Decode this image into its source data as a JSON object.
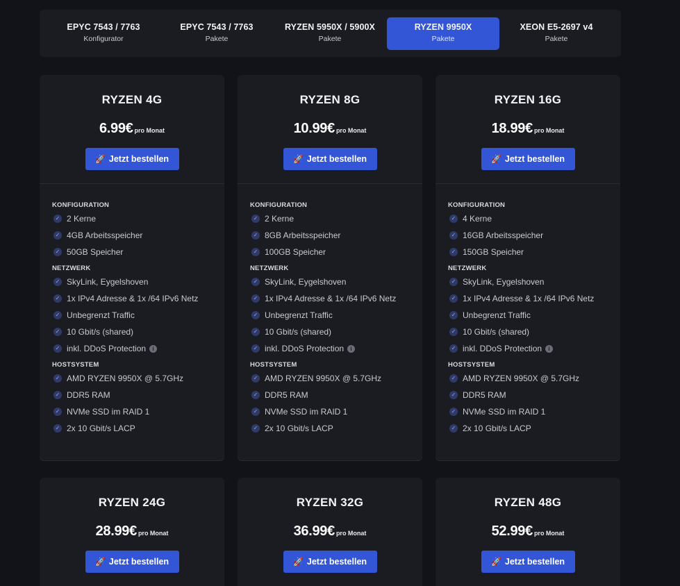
{
  "tabs": [
    {
      "title": "EPYC 7543 / 7763",
      "subtitle": "Konfigurator",
      "active": false
    },
    {
      "title": "EPYC 7543 / 7763",
      "subtitle": "Pakete",
      "active": false
    },
    {
      "title": "RYZEN 5950X / 5900X",
      "subtitle": "Pakete",
      "active": false
    },
    {
      "title": "RYZEN 9950X",
      "subtitle": "Pakete",
      "active": true
    },
    {
      "title": "XEON E5-2697 v4",
      "subtitle": "Pakete",
      "active": false
    }
  ],
  "colors": {
    "accent": "#3356d6",
    "background": "#121318",
    "card": "#1b1c22"
  },
  "icons": {
    "order": "rocket-icon",
    "check": "check-circle-icon",
    "info": "info-icon"
  },
  "labels": {
    "per_month": "pro Monat",
    "order_button": "Jetzt bestellen",
    "section_config": "KONFIGURATION",
    "section_network": "NETZWERK",
    "section_host": "HOSTSYSTEM"
  },
  "plans": [
    {
      "name": "RYZEN 4G",
      "price": "6.99€",
      "config": [
        "2 Kerne",
        "4GB Arbeitsspeicher",
        "50GB Speicher"
      ],
      "network": [
        "SkyLink, Eygelshoven",
        "1x IPv4 Adresse & 1x /64 IPv6 Netz",
        "Unbegrenzt Traffic",
        "10 Gbit/s (shared)",
        "inkl. DDoS Protection"
      ],
      "host": [
        "AMD RYZEN 9950X @ 5.7GHz",
        "DDR5 RAM",
        "NVMe SSD im RAID 1",
        "2x 10 Gbit/s LACP"
      ]
    },
    {
      "name": "RYZEN 8G",
      "price": "10.99€",
      "config": [
        "2 Kerne",
        "8GB Arbeitsspeicher",
        "100GB Speicher"
      ],
      "network": [
        "SkyLink, Eygelshoven",
        "1x IPv4 Adresse & 1x /64 IPv6 Netz",
        "Unbegrenzt Traffic",
        "10 Gbit/s (shared)",
        "inkl. DDoS Protection"
      ],
      "host": [
        "AMD RYZEN 9950X @ 5.7GHz",
        "DDR5 RAM",
        "NVMe SSD im RAID 1",
        "2x 10 Gbit/s LACP"
      ]
    },
    {
      "name": "RYZEN 16G",
      "price": "18.99€",
      "config": [
        "4 Kerne",
        "16GB Arbeitsspeicher",
        "150GB Speicher"
      ],
      "network": [
        "SkyLink, Eygelshoven",
        "1x IPv4 Adresse & 1x /64 IPv6 Netz",
        "Unbegrenzt Traffic",
        "10 Gbit/s (shared)",
        "inkl. DDoS Protection"
      ],
      "host": [
        "AMD RYZEN 9950X @ 5.7GHz",
        "DDR5 RAM",
        "NVMe SSD im RAID 1",
        "2x 10 Gbit/s LACP"
      ]
    },
    {
      "name": "RYZEN 24G",
      "price": "28.99€"
    },
    {
      "name": "RYZEN 32G",
      "price": "36.99€"
    },
    {
      "name": "RYZEN 48G",
      "price": "52.99€"
    }
  ]
}
